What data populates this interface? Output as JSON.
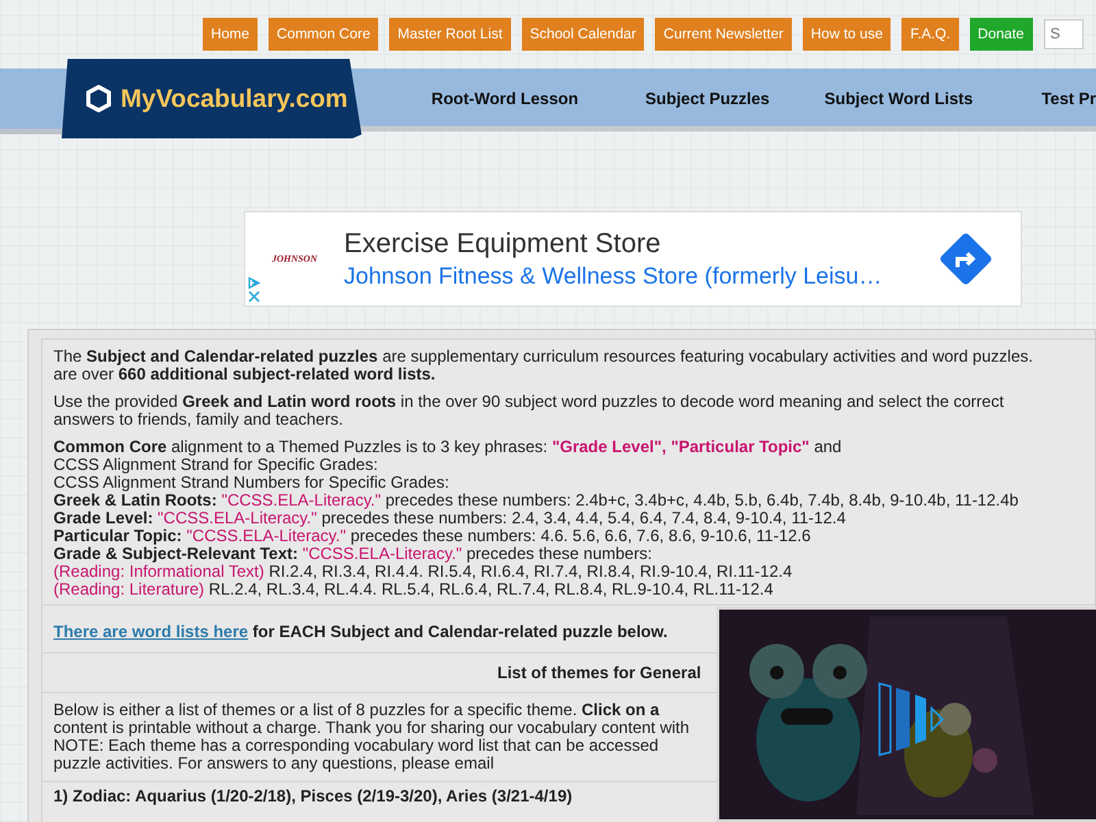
{
  "top_menu": [
    {
      "label": "Home",
      "kind": "link"
    },
    {
      "label": "Common Core",
      "kind": "link"
    },
    {
      "label": "Master Root List",
      "kind": "link"
    },
    {
      "label": "School Calendar",
      "kind": "link"
    },
    {
      "label": "Current Newsletter",
      "kind": "link"
    },
    {
      "label": "How to use",
      "kind": "link"
    },
    {
      "label": "F.A.Q.",
      "kind": "link"
    },
    {
      "label": "Donate",
      "kind": "donate"
    }
  ],
  "search": {
    "placeholder": "S"
  },
  "logo": {
    "text": "MyVocabulary.com"
  },
  "main_nav": [
    "Root-Word Lesson",
    "Subject Puzzles",
    "Subject Word Lists",
    "Test Pr"
  ],
  "ad": {
    "brand": "JOHNSON",
    "headline": "Exercise Equipment Store",
    "subline": "Johnson Fitness & Wellness Store (formerly Leisu…"
  },
  "intro": [
    {
      "lines": [
        [
          {
            "kind": "plain",
            "text": "The "
          },
          {
            "kind": "bold",
            "text": "Subject and Calendar-related puzzles"
          },
          {
            "kind": "plain",
            "text": " are supplementary curriculum resources featuring vocabulary activities and word puzzles."
          }
        ],
        [
          {
            "kind": "plain",
            "text": "are over "
          },
          {
            "kind": "bold",
            "text": "660 additional subject-related word lists."
          }
        ]
      ]
    },
    {
      "lines": [
        [
          {
            "kind": "plain",
            "text": "Use the provided "
          },
          {
            "kind": "bold",
            "text": "Greek and Latin word roots"
          },
          {
            "kind": "plain",
            "text": " in the over 90 subject word puzzles to decode word meaning and select the correct"
          }
        ],
        [
          {
            "kind": "plain",
            "text": "answers to friends, family and teachers."
          }
        ]
      ]
    },
    {
      "lines": [
        [
          {
            "kind": "bold",
            "text": "Common Core"
          },
          {
            "kind": "plain",
            "text": " alignment to a Themed Puzzles is to 3 key phrases: "
          },
          {
            "kind": "phrase",
            "text": "\"Grade Level\","
          },
          {
            "kind": "phrase",
            "text": " \"Particular Topic\""
          },
          {
            "kind": "plain",
            "text": " and"
          }
        ],
        [
          {
            "kind": "plain",
            "text": "CCSS Alignment Strand for Specific Grades:"
          }
        ],
        [
          {
            "kind": "plain",
            "text": "CCSS Alignment Strand Numbers for Specific Grades:"
          }
        ],
        [
          {
            "kind": "bold",
            "text": "Greek & Latin Roots: "
          },
          {
            "kind": "code",
            "text": "\"CCSS.ELA-Literacy.\""
          },
          {
            "kind": "plain",
            "text": " precedes these numbers: 2.4b+c, 3.4b+c, 4.4b, 5.b, 6.4b, 7.4b, 8.4b, 9-10.4b, 11-12.4b"
          }
        ],
        [
          {
            "kind": "bold",
            "text": "Grade Level: "
          },
          {
            "kind": "code",
            "text": "\"CCSS.ELA-Literacy.\""
          },
          {
            "kind": "plain",
            "text": " precedes these numbers: 2.4, 3.4, 4.4, 5.4, 6.4, 7.4, 8.4, 9-10.4, 11-12.4"
          }
        ],
        [
          {
            "kind": "bold",
            "text": "Particular Topic: "
          },
          {
            "kind": "code",
            "text": "\"CCSS.ELA-Literacy.\""
          },
          {
            "kind": "plain",
            "text": " precedes these numbers: 4.6. 5.6, 6.6, 7.6, 8.6, 9-10.6, 11-12.6"
          }
        ],
        [
          {
            "kind": "bold",
            "text": "Grade & Subject-Relevant Text: "
          },
          {
            "kind": "code",
            "text": "\"CCSS.ELA-Literacy.\""
          },
          {
            "kind": "plain",
            "text": " precedes these numbers:"
          }
        ],
        [
          {
            "kind": "code",
            "text": "(Reading: Informational Text)"
          },
          {
            "kind": "plain",
            "text": " RI.2.4, RI.3.4, RI.4.4. RI.5.4, RI.6.4, RI.7.4, RI.8.4, RI.9-10.4, RI.11-12.4"
          }
        ],
        [
          {
            "kind": "code",
            "text": "(Reading: Literature)"
          },
          {
            "kind": "plain",
            "text": " RL.2.4, RL.3.4, RL.4.4. RL.5.4, RL.6.4, RL.7.4, RL.8.4, RL.9-10.4, RL.11-12.4"
          }
        ]
      ]
    }
  ],
  "word_lists_row": {
    "link": "There are word lists here",
    "text": "for EACH Subject and Calendar-related puzzle below."
  },
  "themes_heading": "List of themes for General",
  "themes_intro": {
    "lines": [
      [
        {
          "kind": "plain",
          "text": "Below is either a list of themes or a list of 8 puzzles for a specific theme. "
        },
        {
          "kind": "bold",
          "text": "Click on a"
        }
      ],
      [
        {
          "kind": "plain",
          "text": "content is printable without a charge. Thank you for sharing our vocabulary content with"
        }
      ],
      [
        {
          "kind": "plain",
          "text": "NOTE: Each theme has a corresponding vocabulary word list that can be accessed"
        }
      ],
      [
        {
          "kind": "plain",
          "text": "puzzle activities. For answers to any questions, please email"
        }
      ]
    ]
  },
  "themes": [
    "1) Zodiac: Aquarius (1/20-2/18), Pisces (2/19-3/20), Aries (3/21-4/19)"
  ],
  "video": {
    "kind": "picture"
  }
}
